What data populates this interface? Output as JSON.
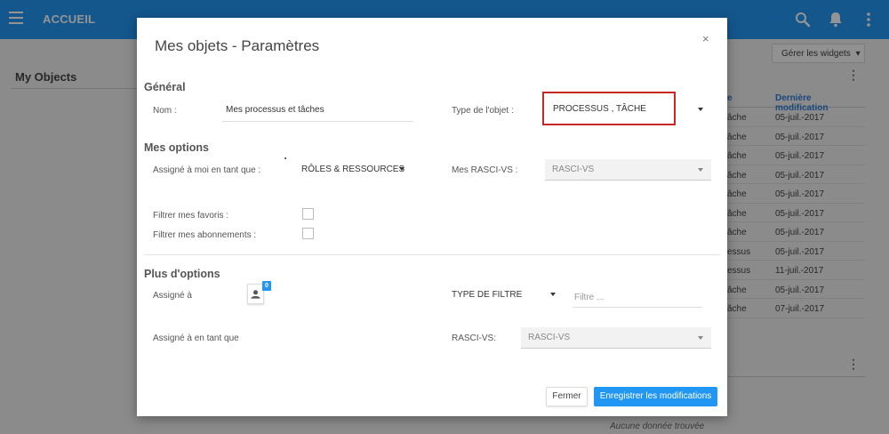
{
  "topbar": {
    "title": "ACCUEIL",
    "menu_icon": "hamburger-menu-icon",
    "search_icon": "search-icon",
    "bell_icon": "bell-icon",
    "more_icon": "more-vertical-icon",
    "color": "#2196f3"
  },
  "background": {
    "page_title": "My Objects",
    "widgets_button": "Gérer les widgets",
    "table": {
      "headers": [
        "e",
        "Dernière modification"
      ],
      "rows": [
        [
          "âche",
          "05-juil.-2017"
        ],
        [
          "âche",
          "05-juil.-2017"
        ],
        [
          "âche",
          "05-juil.-2017"
        ],
        [
          "âche",
          "05-juil.-2017"
        ],
        [
          "âche",
          "05-juil.-2017"
        ],
        [
          "âche",
          "05-juil.-2017"
        ],
        [
          "âche",
          "05-juil.-2017"
        ],
        [
          "essus",
          "05-juil.-2017"
        ],
        [
          "essus",
          "11-juil.-2017"
        ],
        [
          "âche",
          "05-juil.-2017"
        ],
        [
          "âche",
          "07-juil.-2017"
        ]
      ]
    },
    "no_data": "Aucune donnée trouvée"
  },
  "modal": {
    "title": "Mes objets - Paramètres",
    "close": "×",
    "general": {
      "heading": "Général",
      "name_label": "Nom :",
      "name_value": "Mes processus et tâches",
      "type_label": "Type de l'objet :",
      "type_value": "PROCESSUS , TÂCHE"
    },
    "my_options": {
      "heading": "Mes options",
      "assigned_label": "Assigné à moi en tant que :",
      "assigned_value": "RÔLES & RESSOURCES",
      "rasci_label": "Mes RASCI-VS :",
      "rasci_value": "RASCI-VS",
      "favorites_label": "Filtrer mes favoris :",
      "subscriptions_label": "Filtrer mes abonnements :"
    },
    "more_options": {
      "heading": "Plus d'options",
      "assigned_to_label": "Assigné à",
      "badge_count": "0",
      "filter_type_label": "TYPE DE FILTRE",
      "filter_placeholder": "Filtre ...",
      "assigned_as_label": "Assigné à en tant que",
      "rasci_label": "RASCI-VS:",
      "rasci_value": "RASCI-VS"
    },
    "buttons": {
      "cancel": "Fermer",
      "save": "Enregistrer les modifications"
    },
    "highlight_color": "#c62828"
  }
}
